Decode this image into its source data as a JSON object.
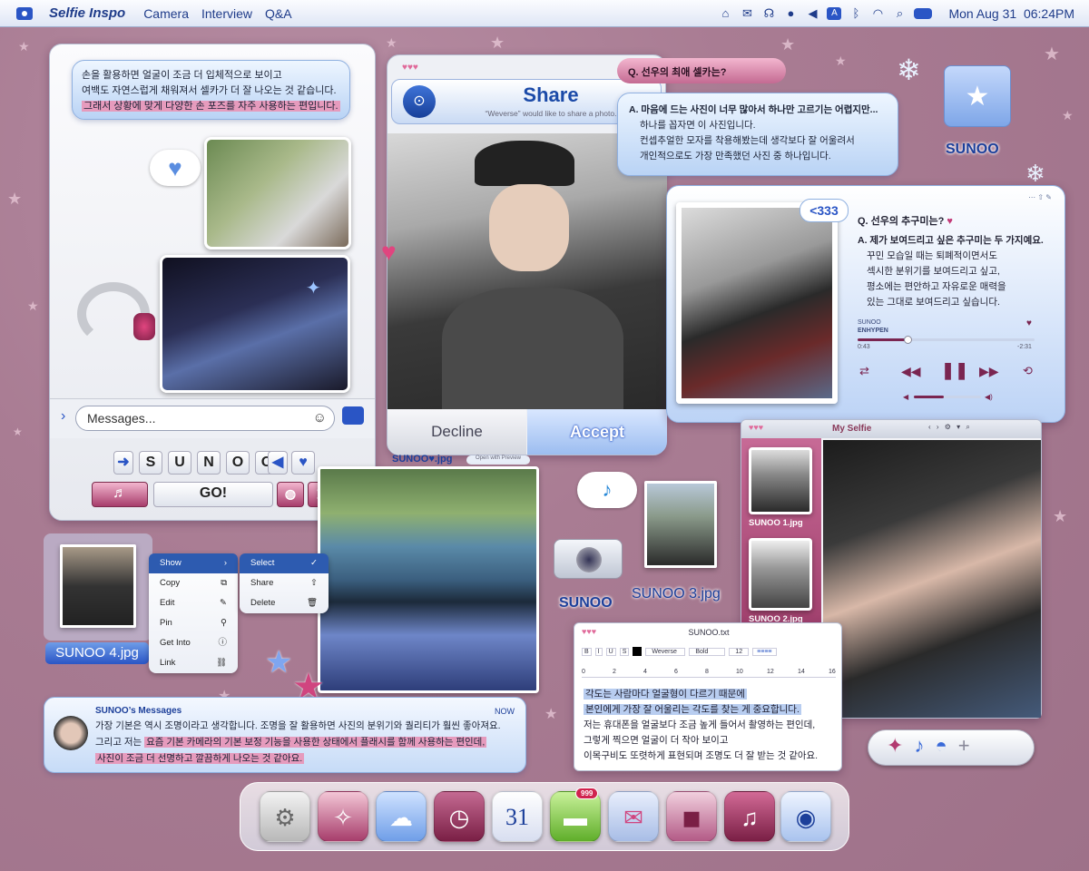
{
  "menubar": {
    "app": "Selfie Inspo",
    "items": [
      "Camera",
      "Interview",
      "Q&A"
    ],
    "clock": "Mon Aug 31  06:24PM",
    "status_icons": [
      "home-icon",
      "mail-icon",
      "headphones-icon",
      "mic-icon",
      "volume-icon",
      "keyboard-a-icon",
      "bluetooth-icon",
      "wifi-icon",
      "search-icon",
      "toggle-icon"
    ]
  },
  "chat": {
    "bubble_line1": "손을 활용하면 얼굴이 조금 더 입체적으로 보이고",
    "bubble_line2": "여백도 자연스럽게 채워져서 셀카가 더 잘 나오는 것 같습니다.",
    "bubble_line3": "그래서 상황에 맞게 다양한 손 포즈를 자주 사용하는 편입니다.",
    "input_placeholder": "Messages...",
    "keys": [
      "S",
      "U",
      "N",
      "O",
      "O"
    ],
    "go": "GO!"
  },
  "share": {
    "title": "Share",
    "subtitle": "“Weverse” would like to share a photo.",
    "decline": "Decline",
    "accept": "Accept"
  },
  "qa1": {
    "question": "Q. 선우의 최애 셀카는?",
    "a1": "A. 마음에 드는 사진이 너무 많아서 하나만 고르기는 어렵지만...",
    "a2": "하나를 꼽자면 이 사진입니다.",
    "a3": "컨셉추얼한 모자를 착용해봤는데 생각보다 잘 어울려서",
    "a4": "개인적으로도 가장 만족했던 사진 중 하나입니다."
  },
  "folder_label": "SUNOO",
  "qa2": {
    "sticker": "<333",
    "question": "Q. 선우의 추구미는?",
    "a1": "A. 제가 보여드리고 싶은 추구미는 두 가지예요.",
    "a2": "꾸민 모습일 때는 퇴폐적이면서도",
    "a3": "섹시한 분위기를 보여드리고 싶고,",
    "a4": "평소에는 편안하고 자유로운 매력을",
    "a5": "있는 그대로 보여드리고 싶습니다.",
    "song": "SUNOO",
    "artist": "ENHYPEN",
    "elapsed": "0:43",
    "remaining": "-2:31",
    "progress": 0.28,
    "volume": 0.45
  },
  "finder": {
    "title": "My Selfie",
    "thumb1": "SUNOO 1.jpg",
    "thumb2": "SUNOO 2.jpg"
  },
  "file_sunoo_heart": "SUNOO♥.jpg",
  "open_preview": "Open with Preview",
  "camera_label": "SUNOO",
  "file3": "SUNOO 3.jpg",
  "file4": "SUNOO 4.jpg",
  "context_menu": {
    "left": [
      "Show",
      "Copy",
      "Edit",
      "Pin",
      "Get Into",
      "Link"
    ],
    "right": [
      "Select",
      "Share",
      "Delete"
    ]
  },
  "messages": {
    "sender": "SUNOO’s Messages",
    "time": "NOW",
    "l1": "가장 기본은 역시 조명이라고 생각합니다. 조명을 잘 활용하면 사진의 분위기와 퀄리티가 훨씬 좋아져요.",
    "l2a": "그리고 저는 ",
    "l2b": "요즘 기본 카메라의 기본 보정 기능을 사용한 상태에서 플래시를 함께 사용하는 편인데,",
    "l3": "사진이 조금 더 선명하고 깔끔하게 나오는 것 같아요."
  },
  "textedit": {
    "title": "SUNOO.txt",
    "font": "Weverse",
    "weight": "Bold",
    "size": "12",
    "ruler": [
      "0",
      "2",
      "4",
      "6",
      "8",
      "10",
      "12",
      "14",
      "16"
    ],
    "l1": "각도는 사람마다 얼굴형이 다르기 때문에",
    "l2": "본인에게 가장 잘 어울리는 각도를 찾는 게 중요합니다.",
    "l3": "저는 휴대폰을 얼굴보다 조금 높게 들어서 촬영하는 편인데,",
    "l4": "그렇게 찍으면 얼굴이 더 작아 보이고",
    "l5": "이목구비도 또렷하게 표현되며 조명도 더 잘 받는 것 같아요."
  },
  "dock": {
    "calendar_day": "31",
    "badge": "999"
  },
  "colors": {
    "accent": "#2a55c5",
    "pink": "#a73d6b",
    "bg": "#a97c93"
  }
}
